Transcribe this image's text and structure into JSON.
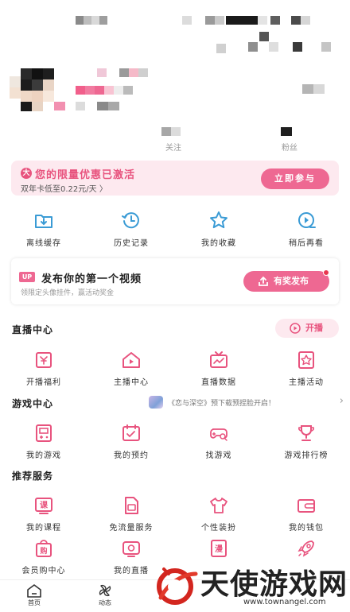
{
  "profile": {
    "stats": [
      {
        "label": "关注"
      },
      {
        "label": "粉丝"
      }
    ]
  },
  "promo": {
    "badge": "大",
    "title": "您的限量优惠已激活",
    "subtitle": "双年卡低至0.22元/天 〉",
    "button": "立即参与"
  },
  "quick_actions": [
    {
      "label": "离线缓存",
      "icon": "offline-cache-icon"
    },
    {
      "label": "历史记录",
      "icon": "history-icon"
    },
    {
      "label": "我的收藏",
      "icon": "star-icon"
    },
    {
      "label": "稍后再看",
      "icon": "watch-later-icon"
    }
  ],
  "upload": {
    "tag": "UP",
    "title": "发布你的第一个视频",
    "subtitle": "领限定头像挂件，赢活动奖金",
    "button": "有奖发布"
  },
  "live_center": {
    "title": "直播中心",
    "button": "开播",
    "items": [
      {
        "label": "开播福利",
        "icon": "gift-icon"
      },
      {
        "label": "主播中心",
        "icon": "streamer-home-icon"
      },
      {
        "label": "直播数据",
        "icon": "tv-chart-icon"
      },
      {
        "label": "主播活动",
        "icon": "star-badge-icon"
      }
    ]
  },
  "game_center": {
    "title": "游戏中心",
    "promo_text": "《恋与深空》预下载预捏脸开启！",
    "items": [
      {
        "label": "我的游戏",
        "icon": "game-console-icon"
      },
      {
        "label": "我的预约",
        "icon": "calendar-check-icon"
      },
      {
        "label": "找游戏",
        "icon": "gamepad-search-icon"
      },
      {
        "label": "游戏排行榜",
        "icon": "trophy-icon"
      }
    ]
  },
  "services": {
    "title": "推荐服务",
    "items": [
      {
        "label": "我的课程",
        "icon": "course-icon",
        "badge": "课"
      },
      {
        "label": "免流量服务",
        "icon": "sim-card-icon"
      },
      {
        "label": "个性装扮",
        "icon": "tshirt-icon"
      },
      {
        "label": "我的钱包",
        "icon": "wallet-icon"
      },
      {
        "label": "会员购中心",
        "icon": "shopping-bag-icon",
        "badge": "购"
      },
      {
        "label": "我的直播",
        "icon": "live-tv-icon"
      },
      {
        "label": "",
        "icon": "comic-icon",
        "badge": "漫"
      },
      {
        "label": "",
        "icon": "rocket-icon"
      }
    ]
  },
  "bottom_nav": [
    {
      "label": "首页",
      "icon": "home-icon"
    },
    {
      "label": "动态",
      "icon": "pinwheel-icon"
    }
  ],
  "watermark": {
    "text": "天使游戏网",
    "url": "www.townangel.com"
  },
  "colors": {
    "brand_pink": "#ee6892",
    "promo_bg": "#fde9ef",
    "blue_icon": "#3a9bd5"
  }
}
